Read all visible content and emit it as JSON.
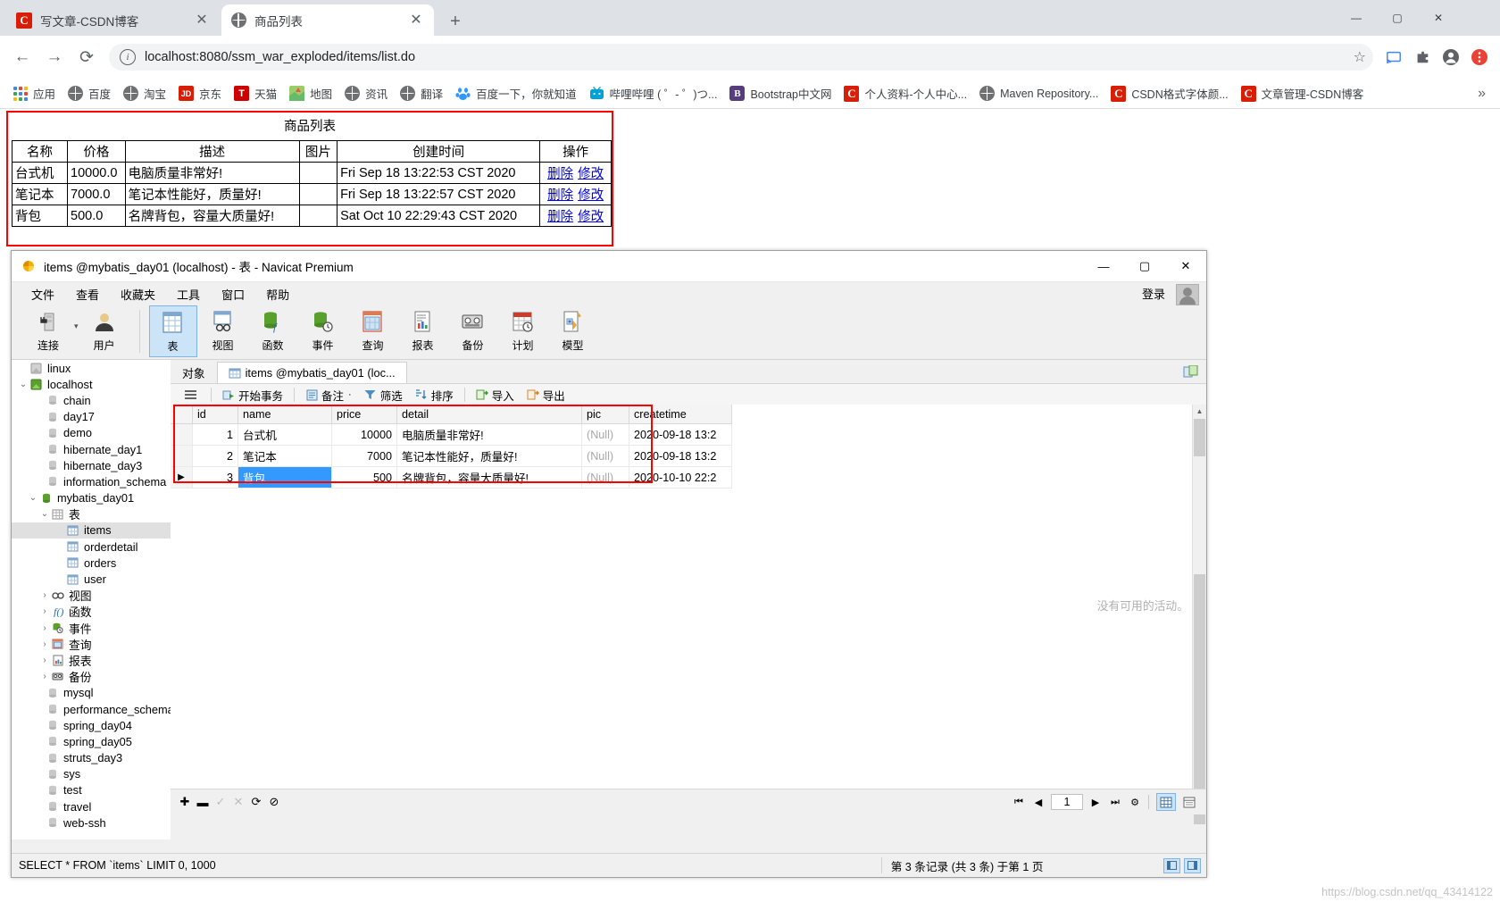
{
  "browser": {
    "tabs": [
      {
        "title": "写文章-CSDN博客",
        "icon": "csdn-icon",
        "active": false
      },
      {
        "title": "商品列表",
        "icon": "globe-icon",
        "active": true
      }
    ],
    "new_tab_label": "+",
    "window_controls": {
      "minimize": "—",
      "maximize": "▢",
      "close": "✕"
    },
    "nav": {
      "back": "←",
      "forward": "→",
      "reload": "⟳"
    },
    "omnibox": {
      "info_icon": "i",
      "url": "localhost:8080/ssm_war_exploded/items/list.do",
      "star": "☆"
    },
    "toolbar_icons": [
      "cast-icon",
      "extensions-icon",
      "profile-icon",
      "menu-icon"
    ],
    "bookmarks": [
      {
        "label": "应用",
        "icon": "apps-grid-icon"
      },
      {
        "label": "百度",
        "icon": "globe-icon"
      },
      {
        "label": "淘宝",
        "icon": "globe-icon"
      },
      {
        "label": "京东",
        "icon": "jd-icon"
      },
      {
        "label": "天猫",
        "icon": "tmall-icon"
      },
      {
        "label": "地图",
        "icon": "map-icon"
      },
      {
        "label": "资讯",
        "icon": "globe-icon"
      },
      {
        "label": "翻译",
        "icon": "globe-icon"
      },
      {
        "label": "百度一下，你就知道",
        "icon": "baidu-icon"
      },
      {
        "label": "哔哩哔哩 ( ゜- ゜)つ...",
        "icon": "bilibili-icon"
      },
      {
        "label": "Bootstrap中文网",
        "icon": "bootstrap-icon"
      },
      {
        "label": "个人资料-个人中心...",
        "icon": "csdn-icon"
      },
      {
        "label": "Maven Repository...",
        "icon": "globe-icon"
      },
      {
        "label": "CSDN格式字体颜...",
        "icon": "csdn-icon"
      },
      {
        "label": "文章管理-CSDN博客",
        "icon": "csdn-icon"
      }
    ],
    "bookmarks_overflow": "»"
  },
  "page": {
    "title": "商品列表",
    "table": {
      "headers": [
        "名称",
        "价格",
        "描述",
        "图片",
        "创建时间",
        "操作"
      ],
      "rows": [
        {
          "name": "台式机",
          "price": "10000.0",
          "desc": "电脑质量非常好!",
          "pic": "",
          "time": "Fri Sep 18 13:22:53 CST 2020",
          "del": "删除",
          "edit": "修改"
        },
        {
          "name": "笔记本",
          "price": "7000.0",
          "desc": "笔记本性能好，质量好!",
          "pic": "",
          "time": "Fri Sep 18 13:22:57 CST 2020",
          "del": "删除",
          "edit": "修改"
        },
        {
          "name": "背包",
          "price": "500.0",
          "desc": "名牌背包，容量大质量好!",
          "pic": "",
          "time": "Sat Oct 10 22:29:43 CST 2020",
          "del": "删除",
          "edit": "修改"
        }
      ]
    },
    "highlight_color": "#ff0000"
  },
  "navicat": {
    "title": "items @mybatis_day01 (localhost) - 表 - Navicat Premium",
    "window_controls": {
      "minimize": "—",
      "maximize": "▢",
      "close": "✕"
    },
    "menu": [
      "文件",
      "查看",
      "收藏夹",
      "工具",
      "窗口",
      "帮助"
    ],
    "login_label": "登录",
    "ribbon": [
      {
        "label": "连接",
        "icon": "connection-icon",
        "selected": false
      },
      {
        "label": "用户",
        "icon": "user-icon",
        "selected": false
      },
      {
        "label": "表",
        "icon": "table-icon",
        "selected": true
      },
      {
        "label": "视图",
        "icon": "view-icon",
        "selected": false
      },
      {
        "label": "函数",
        "icon": "function-icon",
        "selected": false
      },
      {
        "label": "事件",
        "icon": "event-icon",
        "selected": false
      },
      {
        "label": "查询",
        "icon": "query-icon",
        "selected": false
      },
      {
        "label": "报表",
        "icon": "report-icon",
        "selected": false
      },
      {
        "label": "备份",
        "icon": "backup-icon",
        "selected": false
      },
      {
        "label": "计划",
        "icon": "schedule-icon",
        "selected": false
      },
      {
        "label": "模型",
        "icon": "model-icon",
        "selected": false
      }
    ],
    "tree": [
      {
        "label": "linux",
        "indent": 0,
        "twisty": "",
        "icon": "connection-off-icon",
        "selected": false
      },
      {
        "label": "localhost",
        "indent": 0,
        "twisty": "v",
        "icon": "connection-on-icon",
        "selected": false
      },
      {
        "label": "chain",
        "indent": 1,
        "twisty": "",
        "icon": "db-icon",
        "selected": false
      },
      {
        "label": "day17",
        "indent": 1,
        "twisty": "",
        "icon": "db-icon",
        "selected": false
      },
      {
        "label": "demo",
        "indent": 1,
        "twisty": "",
        "icon": "db-icon",
        "selected": false
      },
      {
        "label": "hibernate_day1",
        "indent": 1,
        "twisty": "",
        "icon": "db-icon",
        "selected": false
      },
      {
        "label": "hibernate_day3",
        "indent": 1,
        "twisty": "",
        "icon": "db-icon",
        "selected": false
      },
      {
        "label": "information_schema",
        "indent": 1,
        "twisty": "",
        "icon": "db-icon",
        "selected": false
      },
      {
        "label": "mybatis_day01",
        "indent": 1,
        "twisty": "v",
        "icon": "db-open-icon",
        "selected": false
      },
      {
        "label": "表",
        "indent": 2,
        "twisty": "v",
        "icon": "folder-table-icon",
        "selected": false
      },
      {
        "label": "items",
        "indent": 3,
        "twisty": "",
        "icon": "table-item-icon",
        "selected": true
      },
      {
        "label": "orderdetail",
        "indent": 3,
        "twisty": "",
        "icon": "table-item-icon",
        "selected": false
      },
      {
        "label": "orders",
        "indent": 3,
        "twisty": "",
        "icon": "table-item-icon",
        "selected": false
      },
      {
        "label": "user",
        "indent": 3,
        "twisty": "",
        "icon": "table-item-icon",
        "selected": false
      },
      {
        "label": "视图",
        "indent": 2,
        "twisty": ">",
        "icon": "view-folder-icon",
        "selected": false
      },
      {
        "label": "函数",
        "indent": 2,
        "twisty": ">",
        "icon": "function-folder-icon",
        "selected": false
      },
      {
        "label": "事件",
        "indent": 2,
        "twisty": ">",
        "icon": "event-folder-icon",
        "selected": false
      },
      {
        "label": "查询",
        "indent": 2,
        "twisty": ">",
        "icon": "query-folder-icon",
        "selected": false
      },
      {
        "label": "报表",
        "indent": 2,
        "twisty": ">",
        "icon": "report-folder-icon",
        "selected": false
      },
      {
        "label": "备份",
        "indent": 2,
        "twisty": ">",
        "icon": "backup-folder-icon",
        "selected": false
      },
      {
        "label": "mysql",
        "indent": 1,
        "twisty": "",
        "icon": "db-icon",
        "selected": false
      },
      {
        "label": "performance_schema",
        "indent": 1,
        "twisty": "",
        "icon": "db-icon",
        "selected": false
      },
      {
        "label": "spring_day04",
        "indent": 1,
        "twisty": "",
        "icon": "db-icon",
        "selected": false
      },
      {
        "label": "spring_day05",
        "indent": 1,
        "twisty": "",
        "icon": "db-icon",
        "selected": false
      },
      {
        "label": "struts_day3",
        "indent": 1,
        "twisty": "",
        "icon": "db-icon",
        "selected": false
      },
      {
        "label": "sys",
        "indent": 1,
        "twisty": "",
        "icon": "db-icon",
        "selected": false
      },
      {
        "label": "test",
        "indent": 1,
        "twisty": "",
        "icon": "db-icon",
        "selected": false
      },
      {
        "label": "travel",
        "indent": 1,
        "twisty": "",
        "icon": "db-icon",
        "selected": false
      },
      {
        "label": "web-ssh",
        "indent": 1,
        "twisty": "",
        "icon": "db-icon",
        "selected": false
      }
    ],
    "object_tabs": [
      {
        "label": "对象",
        "active": false,
        "icon": ""
      },
      {
        "label": "items @mybatis_day01 (loc...",
        "active": true,
        "icon": "table-icon"
      }
    ],
    "grid_tools": [
      {
        "label": "",
        "icon": "hamburger-icon"
      },
      {
        "label": "开始事务",
        "icon": "begin-transaction-icon"
      },
      {
        "label": "备注",
        "icon": "note-icon",
        "caret": "·"
      },
      {
        "label": "筛选",
        "icon": "filter-icon"
      },
      {
        "label": "排序",
        "icon": "sort-icon"
      },
      {
        "label": "导入",
        "icon": "import-icon"
      },
      {
        "label": "导出",
        "icon": "export-icon"
      }
    ],
    "grid": {
      "columns": [
        "id",
        "name",
        "price",
        "detail",
        "pic",
        "createtime"
      ],
      "rows": [
        {
          "marker": "",
          "id": "1",
          "name": "台式机",
          "price": "10000",
          "detail": "电脑质量非常好!",
          "pic": "(Null)",
          "createtime": "2020-09-18 13:2",
          "selected_cell": null
        },
        {
          "marker": "",
          "id": "2",
          "name": "笔记本",
          "price": "7000",
          "detail": "笔记本性能好，质量好!",
          "pic": "(Null)",
          "createtime": "2020-09-18 13:2",
          "selected_cell": null
        },
        {
          "marker": "▶",
          "id": "3",
          "name": "背包",
          "price": "500",
          "detail": "名牌背包，容量大质量好!",
          "pic": "(Null)",
          "createtime": "2020-10-10 22:2",
          "selected_cell": "name"
        }
      ]
    },
    "no_activity_text": "没有可用的活动。",
    "bottom_bar_icons": [
      "add-row-icon",
      "remove-row-icon",
      "apply-change-icon",
      "discard-change-icon",
      "refresh-icon",
      "stop-icon"
    ],
    "pager": {
      "first": "⏮",
      "prev": "◀",
      "page": "1",
      "next": "▶",
      "last": "⏭",
      "settings": "⚙",
      "grid_view": "grid-view-icon",
      "form_view": "form-view-icon"
    },
    "status": {
      "sql": "SELECT * FROM `items` LIMIT 0, 1000",
      "records": "第 3 条记录 (共 3 条) 于第 1 页",
      "pane_left": "left-pane-icon",
      "pane_right": "right-pane-icon"
    }
  },
  "watermark": "https://blog.csdn.net/qq_43414122"
}
